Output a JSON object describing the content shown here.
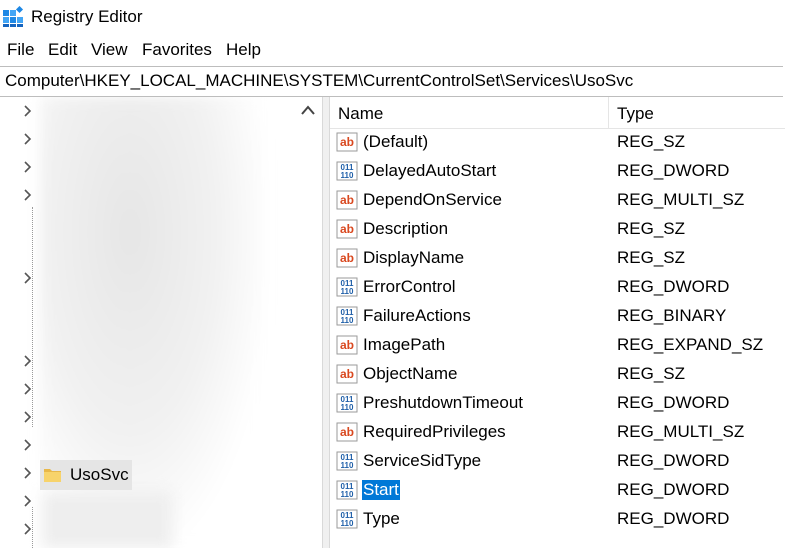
{
  "window": {
    "title": "Registry Editor"
  },
  "menu": [
    "File",
    "Edit",
    "View",
    "Favorites",
    "Help"
  ],
  "address": "Computer\\HKEY_LOCAL_MACHINE\\SYSTEM\\CurrentControlSet\\Services\\UsoSvc",
  "tree": {
    "selected_key": "UsoSvc",
    "icons": {
      "expand": "chevron-right-icon",
      "folder": "folder-icon",
      "scroll": "scroll-up-icon"
    }
  },
  "columns": {
    "name": "Name",
    "type": "Type"
  },
  "values": [
    {
      "name": "(Default)",
      "type": "REG_SZ",
      "icon": "ab"
    },
    {
      "name": "DelayedAutoStart",
      "type": "REG_DWORD",
      "icon": "binary"
    },
    {
      "name": "DependOnService",
      "type": "REG_MULTI_SZ",
      "icon": "ab"
    },
    {
      "name": "Description",
      "type": "REG_SZ",
      "icon": "ab"
    },
    {
      "name": "DisplayName",
      "type": "REG_SZ",
      "icon": "ab"
    },
    {
      "name": "ErrorControl",
      "type": "REG_DWORD",
      "icon": "binary"
    },
    {
      "name": "FailureActions",
      "type": "REG_BINARY",
      "icon": "binary"
    },
    {
      "name": "ImagePath",
      "type": "REG_EXPAND_SZ",
      "icon": "ab"
    },
    {
      "name": "ObjectName",
      "type": "REG_SZ",
      "icon": "ab"
    },
    {
      "name": "PreshutdownTimeout",
      "type": "REG_DWORD",
      "icon": "binary"
    },
    {
      "name": "RequiredPrivileges",
      "type": "REG_MULTI_SZ",
      "icon": "ab"
    },
    {
      "name": "ServiceSidType",
      "type": "REG_DWORD",
      "icon": "binary"
    },
    {
      "name": "Start",
      "type": "REG_DWORD",
      "icon": "binary",
      "selected": true
    },
    {
      "name": "Type",
      "type": "REG_DWORD",
      "icon": "binary"
    }
  ],
  "colors": {
    "selection": "#0078d7",
    "string_icon": "#d9481f",
    "binary_icon": "#1f5fa8"
  }
}
